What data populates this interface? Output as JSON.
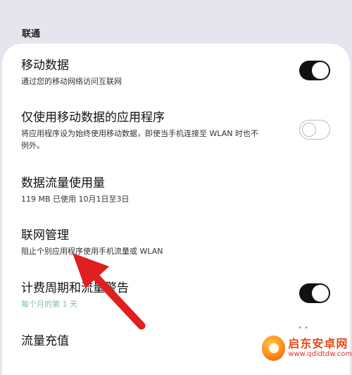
{
  "section_header": "联通",
  "settings": [
    {
      "title": "移动数据",
      "subtitle": "通过您的移动网络访问互联网",
      "toggle": "on"
    },
    {
      "title": "仅使用移动数据的应用程序",
      "subtitle_line1": "将应用程序设为始终使用移动数据，即使当手机连接至 WLAN 时也不",
      "subtitle_line2": "例外。",
      "toggle": "off"
    },
    {
      "title": "数据流量使用量",
      "subtitle": "119 MB 已使用 10月1日至3日"
    },
    {
      "title": "联网管理",
      "subtitle": "阻止个别应用程序使用手机流量或 WLAN"
    },
    {
      "title": "计费周期和流量警告",
      "subtitle": "每个月的第 1 天",
      "toggle": "on"
    },
    {
      "title": "流量充值"
    }
  ],
  "watermark": {
    "name": "启东安卓网",
    "url": "www.qdldtdw.com"
  },
  "colors": {
    "accent": "#7fc0a8",
    "arrow": "#e01f1f",
    "background": "#e6e5ee"
  }
}
